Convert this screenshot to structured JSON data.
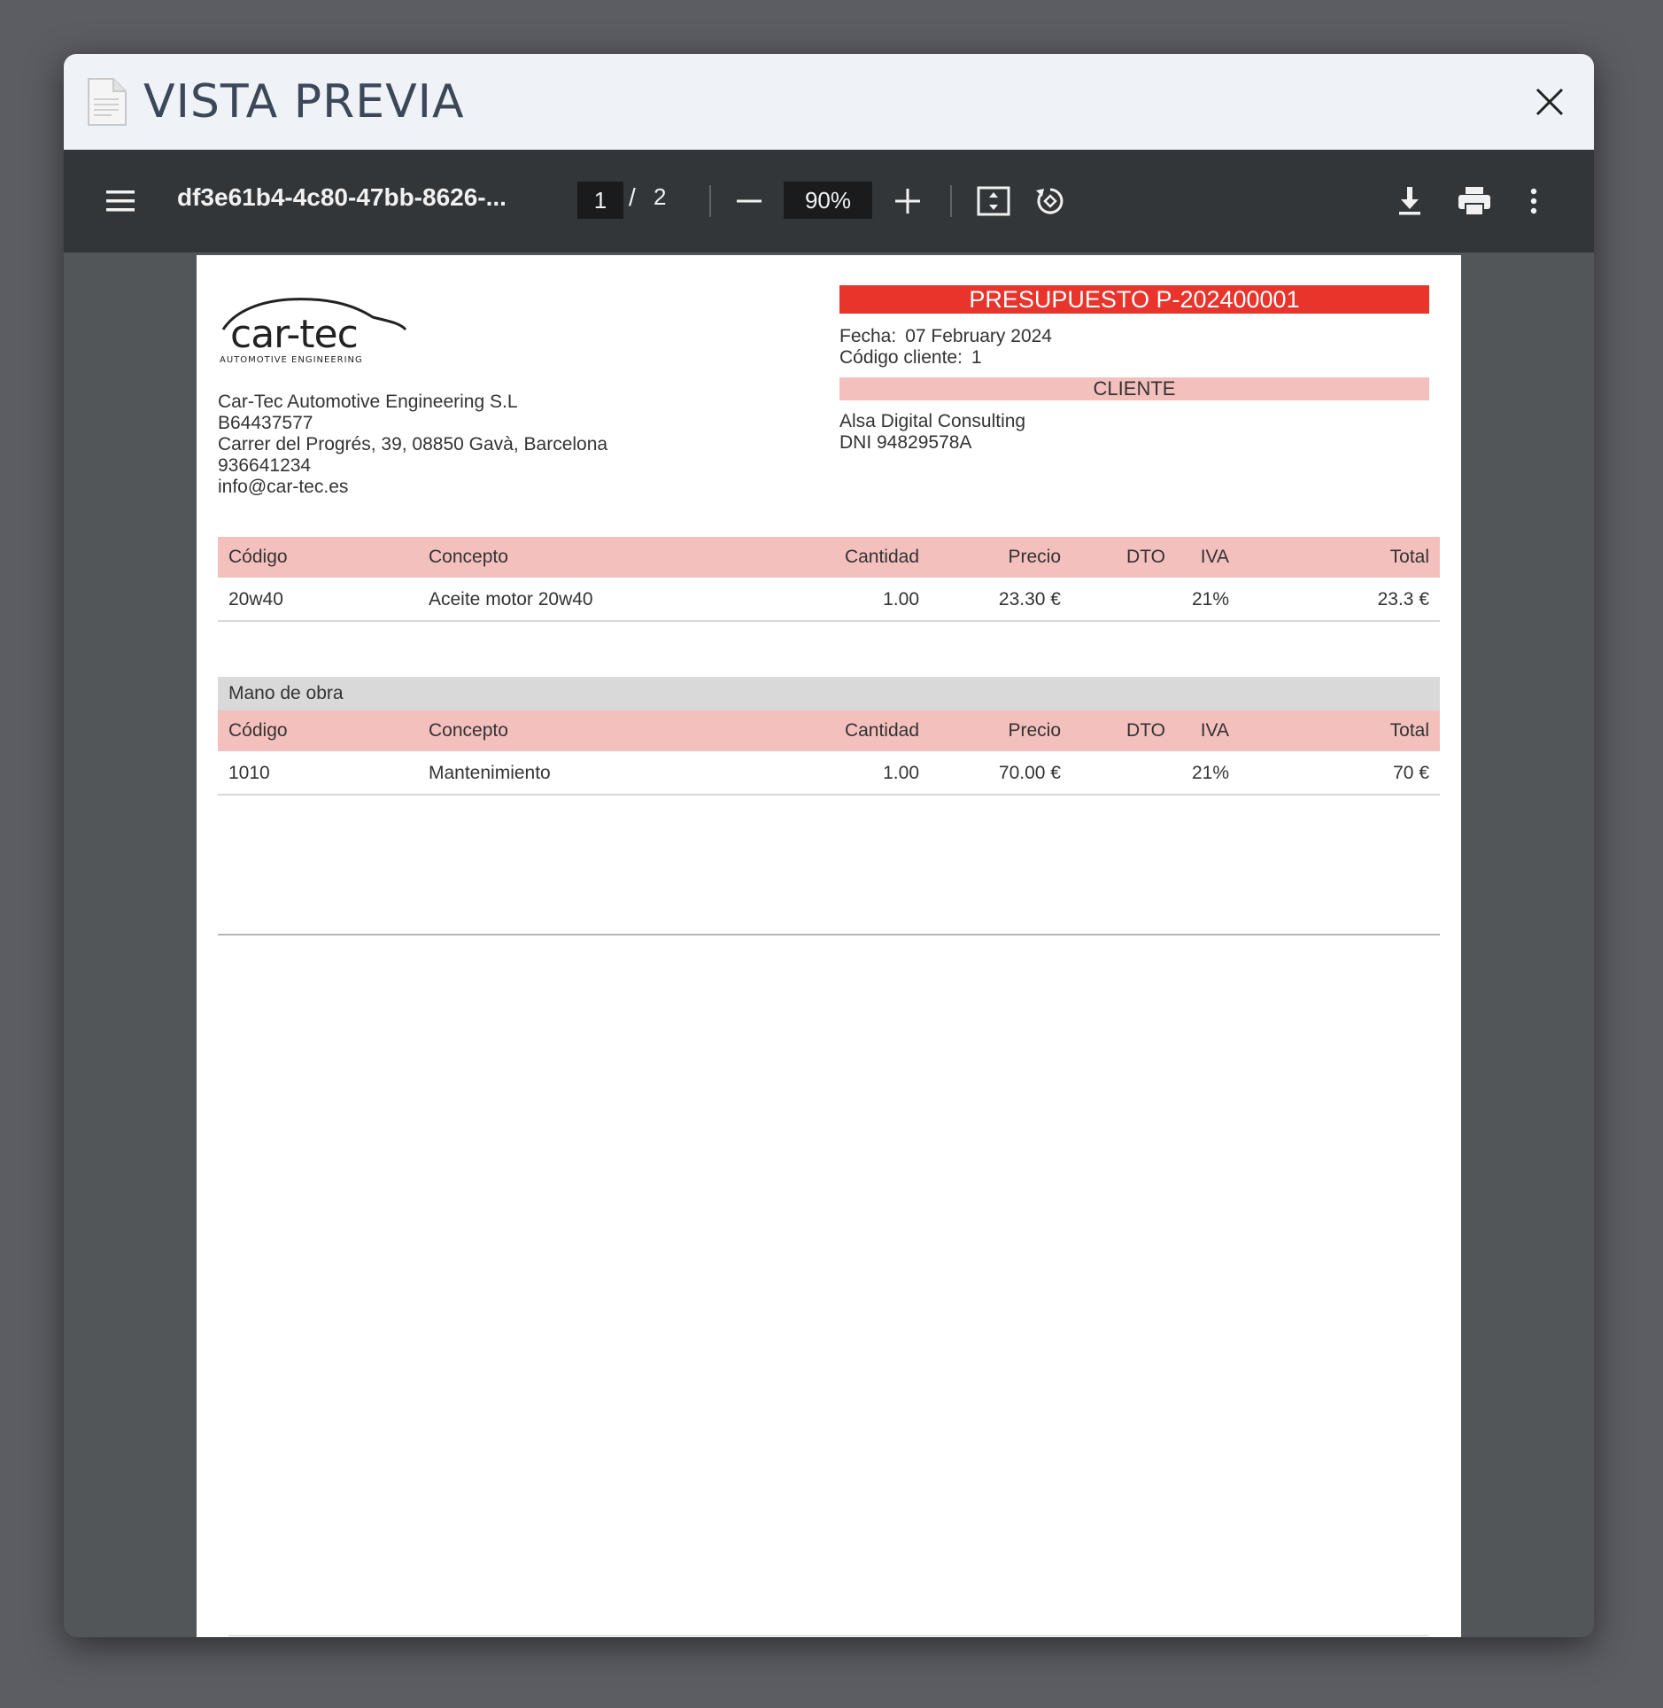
{
  "modal": {
    "title": "VISTA PREVIA"
  },
  "toolbar": {
    "filename": "df3e61b4-4c80-47bb-8626-...",
    "page_current": "1",
    "page_separator": "/",
    "page_total": "2",
    "zoom": "90%"
  },
  "document": {
    "company": {
      "name": "Car-Tec Automotive Engineering S.L",
      "cif": "B64437577",
      "address": "Carrer del Progrés, 39, 08850 Gavà, Barcelona",
      "phone": "936641234",
      "email": "info@car-tec.es",
      "logo_main": "car-tec",
      "logo_sub": "AUTOMOTIVE ENGINEERING"
    },
    "quote_title": "PRESUPUESTO P-202400001",
    "fecha_label": "Fecha:",
    "fecha_value": "07 February 2024",
    "codigo_cliente_label": "Código cliente:",
    "codigo_cliente_value": "1",
    "cliente_header": "CLIENTE",
    "cliente_name": "Alsa Digital Consulting",
    "cliente_dni": "DNI 94829578A",
    "columns": {
      "codigo": "Código",
      "concepto": "Concepto",
      "cantidad": "Cantidad",
      "precio": "Precio",
      "dto": "DTO",
      "iva": "IVA",
      "total": "Total"
    },
    "items": [
      {
        "codigo": "20w40",
        "concepto": "Aceite motor 20w40",
        "cantidad": "1.00",
        "precio": "23.30 €",
        "dto": "",
        "iva": "21%",
        "total": "23.3 €"
      }
    ],
    "labor_section": "Mano de obra",
    "labor_items": [
      {
        "codigo": "1010",
        "concepto": "Mantenimiento",
        "cantidad": "1.00",
        "precio": "70.00 €",
        "dto": "",
        "iva": "21%",
        "total": "70 €"
      }
    ]
  },
  "colors": {
    "accent_red": "#e8342b",
    "pink_header": "#f4c0be",
    "toolbar_bg": "#323639"
  }
}
